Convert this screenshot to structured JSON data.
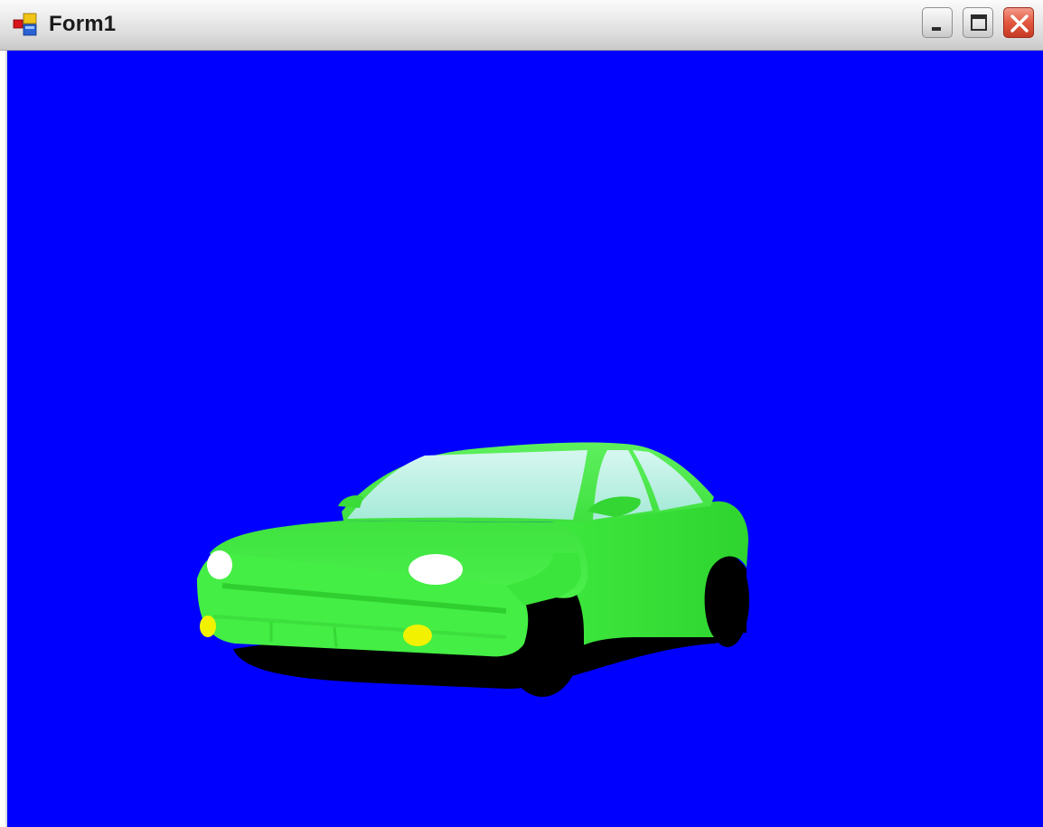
{
  "window": {
    "title": "Form1",
    "icon": "form-app-icon",
    "controls": {
      "minimize_icon": "minimize-icon",
      "maximize_icon": "maximize-icon",
      "close_icon": "close-icon"
    }
  },
  "scene": {
    "background_color": "#0000ff",
    "car_body_color": "#44ee44",
    "window_glass_color": "#b8f0e6",
    "tire_color": "#000000",
    "headlight_color": "#ffffff",
    "foglight_color": "#f2f200"
  }
}
